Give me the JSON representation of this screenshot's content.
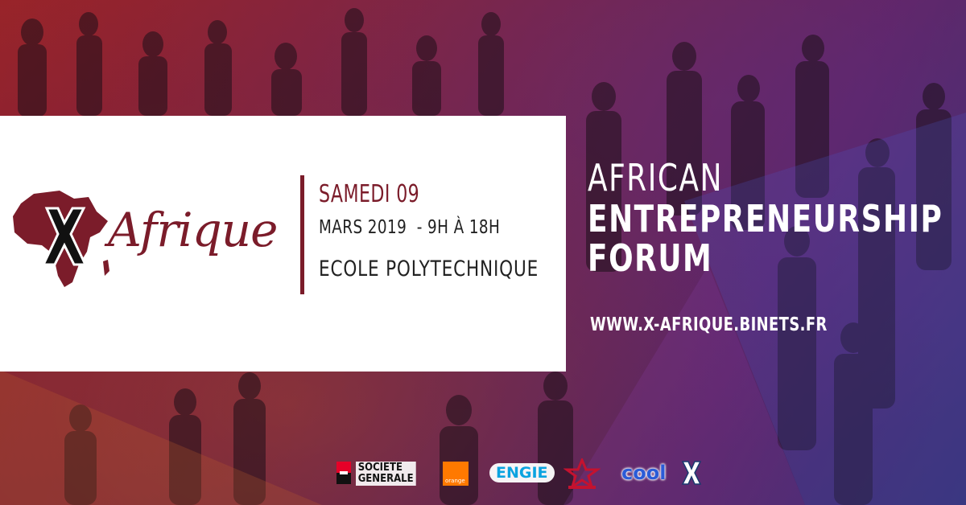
{
  "brand": {
    "logo_word": "Afrique",
    "logo_letter": "X",
    "colors": {
      "maroon": "#7b1c2a",
      "white": "#ffffff",
      "text_dark": "#222222"
    }
  },
  "event": {
    "day": "SAMEDI 09",
    "date_time": "MARS 2019  - 9H À 18H",
    "place": "ECOLE POLYTECHNIQUE"
  },
  "title": {
    "line1": "AFRICAN",
    "line2": "ENTREPRENEURSHIP",
    "line3": "FORUM"
  },
  "website": "WWW.X-AFRIQUE.BINETS.FR",
  "sponsors": {
    "societe_generale": "SOCIETE\nGENERALE",
    "orange": "orange",
    "engie": "ENGIE",
    "royal_air_maroc": "royal-air-maroc-logo",
    "cool": "cool",
    "x": "X"
  }
}
